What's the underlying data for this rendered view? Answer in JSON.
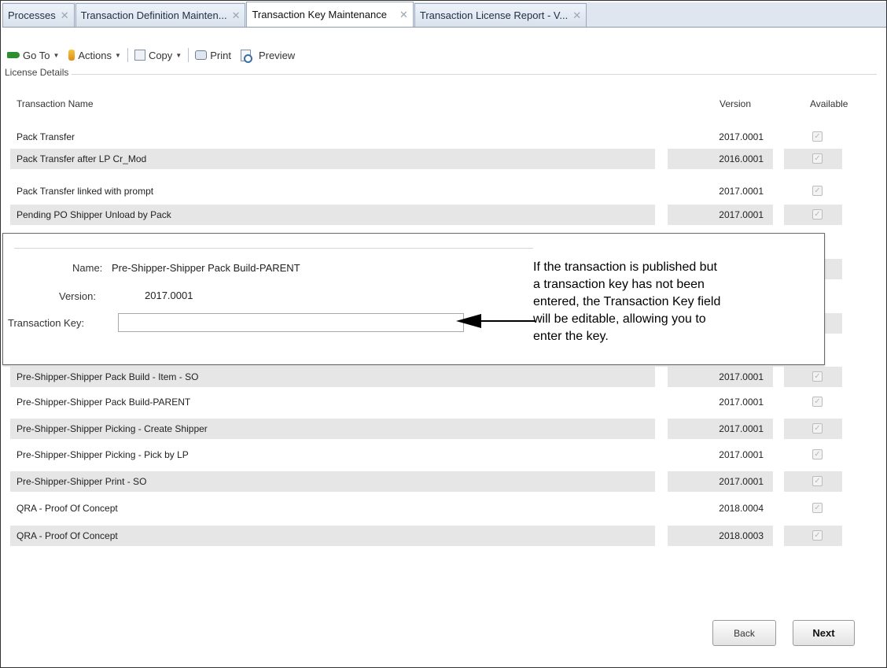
{
  "tabs": [
    {
      "label": "Processes",
      "active": false
    },
    {
      "label": "Transaction Definition Mainten...",
      "active": false
    },
    {
      "label": "Transaction Key Maintenance",
      "active": true
    },
    {
      "label": "Transaction License Report - V...",
      "active": false
    }
  ],
  "tab_close_glyph": "✕",
  "toolbar": {
    "goto_label": "Go To",
    "actions_label": "Actions",
    "copy_label": "Copy",
    "print_label": "Print",
    "preview_label": "Preview"
  },
  "group_title": "License Details",
  "columns": {
    "name": "Transaction Name",
    "version": "Version",
    "available": "Available"
  },
  "rows_top": [
    {
      "name": "Pack Transfer",
      "version": "2017.0001",
      "available": true
    },
    {
      "name": "Pack Transfer after LP Cr_Mod",
      "version": "2016.0001",
      "available": true
    },
    {
      "name": "Pack Transfer linked with prompt",
      "version": "2017.0001",
      "available": true
    },
    {
      "name": "Pending PO Shipper Unload by Pack",
      "version": "2017.0001",
      "available": true
    }
  ],
  "rows_bottom": [
    {
      "name": "Pre-Shipper-Shipper Pack Build - Item - SO",
      "version": "2017.0001",
      "available": true
    },
    {
      "name": "Pre-Shipper-Shipper Pack Build-PARENT",
      "version": "2017.0001",
      "available": true
    },
    {
      "name": "Pre-Shipper-Shipper Picking - Create Shipper",
      "version": "2017.0001",
      "available": true
    },
    {
      "name": "Pre-Shipper-Shipper Picking - Pick by LP",
      "version": "2017.0001",
      "available": true
    },
    {
      "name": "Pre-Shipper-Shipper Print - SO",
      "version": "2017.0001",
      "available": true
    },
    {
      "name": "QRA - Proof Of Concept",
      "version": "2018.0004",
      "available": true
    },
    {
      "name": "QRA - Proof Of Concept",
      "version": "2018.0003",
      "available": true
    }
  ],
  "popup": {
    "name_label": "Name:",
    "name_value": "Pre-Shipper-Shipper Pack Build-PARENT",
    "version_label": "Version:",
    "version_value": "2017.0001",
    "key_label": "Transaction Key:",
    "key_value": ""
  },
  "callout": {
    "lines": [
      "If the transaction is published but",
      "a transaction key has not been",
      "entered, the Transaction Key field",
      "will be editable, allowing you to",
      "enter the key."
    ]
  },
  "buttons": {
    "back": "Back",
    "next": "Next"
  },
  "colors": {
    "tab_bar": "#dfe6ef",
    "row_alt": "#e6e6e6",
    "goto_icon": "#2e8f2e",
    "actions_icon": "#f0a326"
  }
}
